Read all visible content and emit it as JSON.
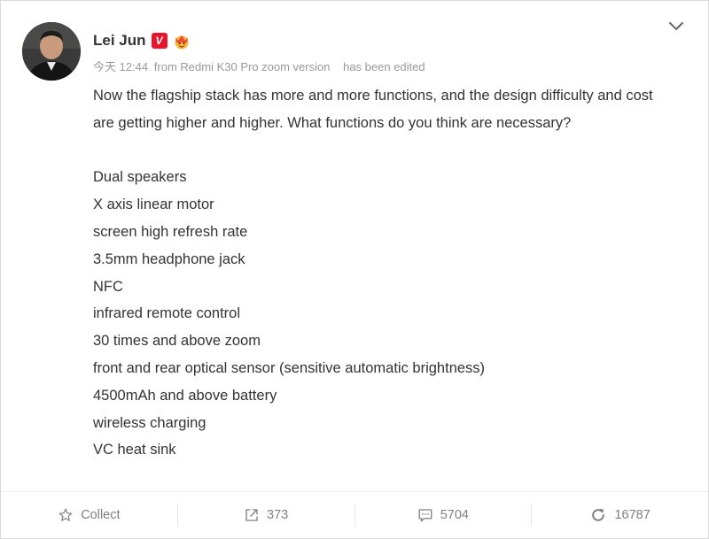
{
  "post": {
    "author": "Lei Jun",
    "verified_badge": "V",
    "time": "今天 12:44",
    "source": "from Redmi K30 Pro zoom version",
    "edited": "has been edited",
    "intro": "Now the flagship stack has more and more functions, and the design difficulty and cost are getting higher and higher. What functions do you think are necessary?",
    "features": [
      "Dual speakers",
      "X axis linear motor",
      "screen high refresh rate",
      "3.5mm headphone jack",
      "NFC",
      "infrared remote control",
      "30 times and above zoom",
      "front and rear optical sensor (sensitive automatic brightness)",
      "4500mAh and above battery",
      "wireless charging",
      "VC heat sink"
    ]
  },
  "actions": {
    "collect": "Collect",
    "forwards": "373",
    "comments": "5704",
    "likes": "16787"
  },
  "icons": {
    "menu": "chevron-down-icon",
    "collect": "star-icon",
    "forward": "share-icon",
    "comment": "comment-icon",
    "like": "refresh-icon"
  },
  "colors": {
    "badge_red": "#e6162d",
    "muted_text": "#999999",
    "action_text": "#808080"
  }
}
